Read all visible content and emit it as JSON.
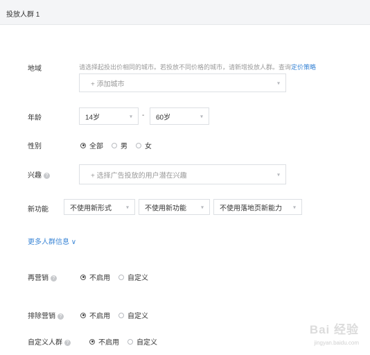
{
  "header": {
    "title": "投放人群 1"
  },
  "region": {
    "label": "地域",
    "hint_text": "请选择起投出价相同的城市。若投放不同价格的城市，请新增投放人群。查询",
    "hint_link": "定价策略",
    "placeholder": "+ 添加城市"
  },
  "age": {
    "label": "年龄",
    "from": "14岁",
    "separator": "-",
    "to": "60岁"
  },
  "gender": {
    "label": "性别",
    "options": [
      "全部",
      "男",
      "女"
    ],
    "selected": "全部"
  },
  "interest": {
    "label": "兴趣",
    "placeholder": "+ 选择广告投放的用户潜在兴趣"
  },
  "new_feature": {
    "label": "新功能",
    "selects": [
      "不使用新形式",
      "不使用新功能",
      "不使用落地页新能力"
    ]
  },
  "more_link": "更多人群信息 ∨",
  "remarketing": {
    "label": "再营销",
    "options": [
      "不启用",
      "自定义"
    ],
    "selected": "不启用"
  },
  "exclude": {
    "label": "排除营销",
    "options": [
      "不启用",
      "自定义"
    ],
    "selected": "不启用"
  },
  "custom_audience": {
    "label": "自定义人群",
    "options": [
      "不启用",
      "自定义"
    ],
    "selected": "不启用"
  },
  "watermark": {
    "brand": "Bai 经验",
    "url": "jingyan.baidu.com"
  }
}
